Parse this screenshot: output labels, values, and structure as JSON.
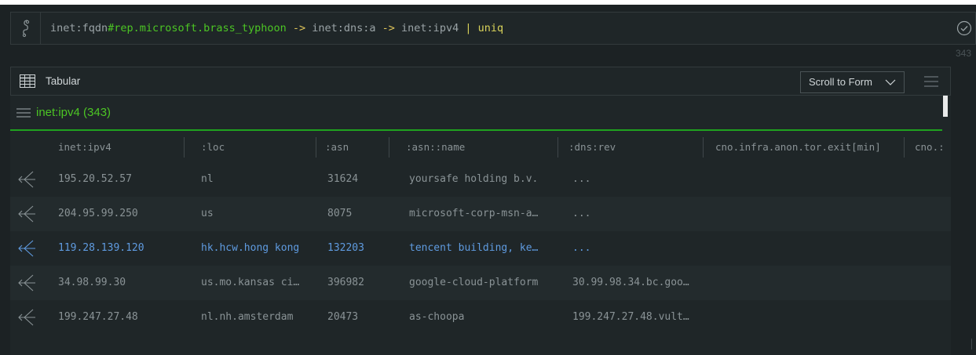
{
  "query": {
    "prefix": "inet:fqdn",
    "tag": "#rep.microsoft.brass_typhoon",
    "arrow1": " -> ",
    "form1": "inet:dns:a",
    "arrow2": " -> ",
    "form2": "inet:ipv4",
    "pipe": " | ",
    "cmd": "uniq"
  },
  "result_count": "343",
  "panel": {
    "tab_label": "Tabular",
    "scroll_button": "Scroll to Form",
    "form_label": "inet:ipv4 (343)"
  },
  "columns": [
    "inet:ipv4",
    ":loc",
    ":asn",
    ":asn::name",
    ":dns:rev",
    "cno.infra.anon.tor.exit[min]",
    "cno.:"
  ],
  "rows": [
    {
      "ipv4": "195.20.52.57",
      "loc": "nl",
      "asn": "31624",
      "asn_name": "yoursafe holding b.v.",
      "dns_rev": "...",
      "selected": false
    },
    {
      "ipv4": "204.95.99.250",
      "loc": "us",
      "asn": "8075",
      "asn_name": "microsoft-corp-msn-a…",
      "dns_rev": "...",
      "selected": false
    },
    {
      "ipv4": "119.28.139.120",
      "loc": "hk.hcw.hong kong",
      "asn": "132203",
      "asn_name": "tencent building, ke…",
      "dns_rev": "...",
      "selected": true
    },
    {
      "ipv4": "34.98.99.30",
      "loc": "us.mo.kansas ci…",
      "asn": "396982",
      "asn_name": "google-cloud-platform",
      "dns_rev": "30.99.98.34.bc.goo…",
      "selected": false
    },
    {
      "ipv4": "199.247.27.48",
      "loc": "nl.nh.amsterdam",
      "asn": "20473",
      "asn_name": "as-choopa",
      "dns_rev": "199.247.27.48.vult…",
      "selected": false
    }
  ],
  "colors": {
    "accent_green": "#4cc524",
    "selected_blue": "#5f9be0",
    "background": "#1c2224"
  }
}
